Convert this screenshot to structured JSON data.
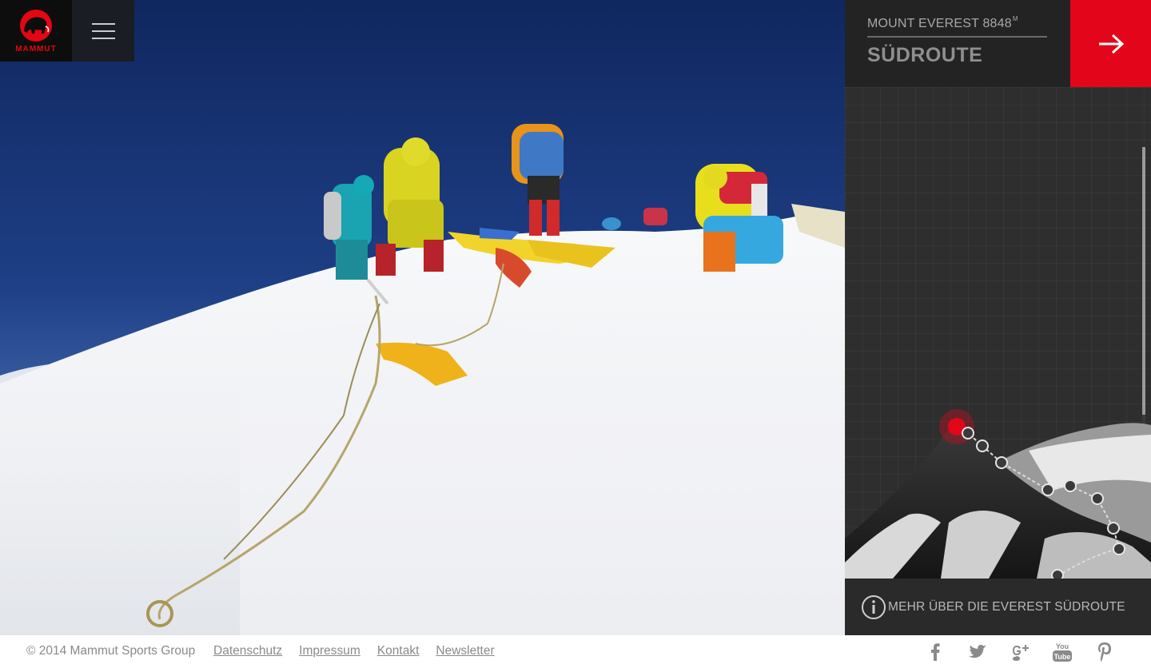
{
  "brand": {
    "name": "MAMMUT",
    "accent": "#e30613"
  },
  "header": {
    "menu_icon": "hamburger-menu-icon"
  },
  "panel": {
    "kicker": "MOUNT EVEREST 8848",
    "kicker_unit": "M",
    "title": "SÜDROUTE",
    "next_icon": "arrow-right-icon",
    "info_text": "MEHR ÜBER DIE EVEREST SÜDROUTE",
    "info_icon": "info-circle-icon"
  },
  "footer": {
    "copyright": "© 2014 Mammut Sports Group",
    "links": [
      "Datenschutz",
      "Impressum",
      "Kontakt",
      "Newsletter"
    ],
    "social": [
      "facebook-icon",
      "twitter-icon",
      "google-plus-icon",
      "youtube-icon",
      "pinterest-icon"
    ],
    "youtube_label": "You Tube"
  },
  "colors": {
    "red": "#e3061a",
    "panel": "#2e2e2e",
    "sky": "#1c3a78"
  }
}
